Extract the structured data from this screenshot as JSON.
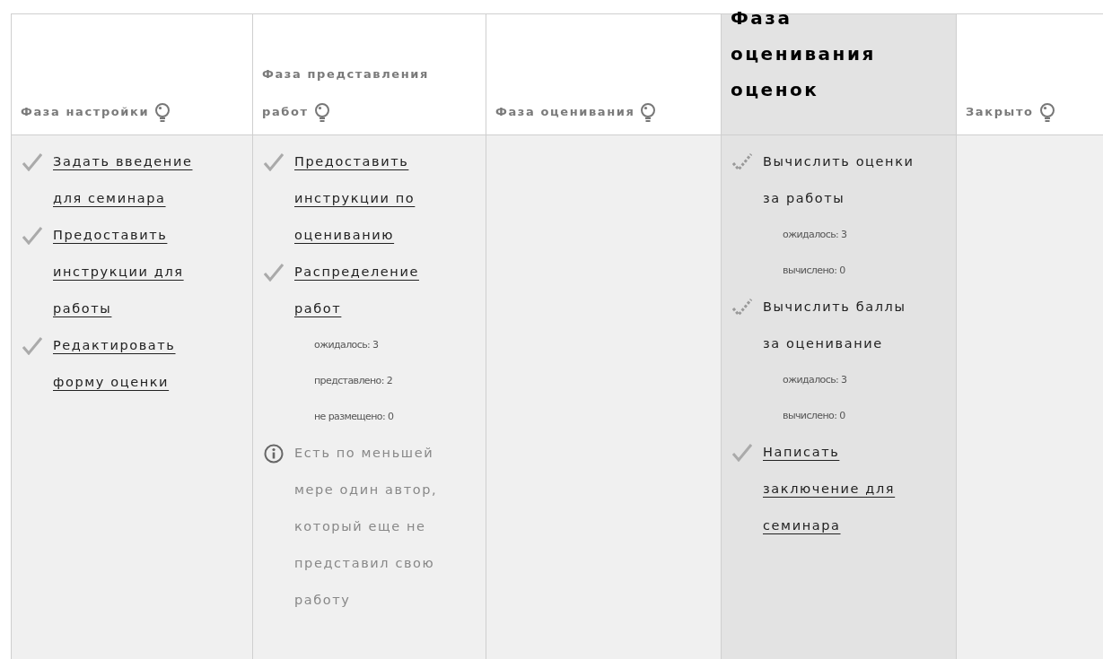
{
  "phases": [
    {
      "title": "Фаза настройки",
      "current": false,
      "tasks": [
        {
          "kind": "done",
          "text": "Задать введение для семинара"
        },
        {
          "kind": "done",
          "text": "Предоставить инструкции для работы"
        },
        {
          "kind": "done",
          "text": "Редактировать форму оценки"
        }
      ]
    },
    {
      "title": "Фаза представления работ",
      "current": false,
      "tasks": [
        {
          "kind": "done",
          "text": "Предоставить инструкции по оцениванию"
        },
        {
          "kind": "done",
          "text": "Распределение работ",
          "details": [
            "ожидалось: 3",
            "представлено: 2",
            "не размещено: 0"
          ]
        },
        {
          "kind": "info",
          "text": "Есть по меньшей мере один автор, который еще не представил свою работу"
        }
      ]
    },
    {
      "title": "Фаза оценивания",
      "current": false
    },
    {
      "title": "Фаза оценивания оценок",
      "current": true,
      "tasks": [
        {
          "kind": "todo",
          "text": "Вычислить оценки за работы",
          "details": [
            "ожидалось: 3",
            "вычислено: 0"
          ]
        },
        {
          "kind": "todo",
          "text": "Вычислить баллы за оценивание",
          "details": [
            "ожидалось: 3",
            "вычислено: 0"
          ]
        },
        {
          "kind": "done",
          "text": "Написать заключение для семинара"
        }
      ]
    },
    {
      "title": "Закрыто",
      "current": false
    }
  ]
}
